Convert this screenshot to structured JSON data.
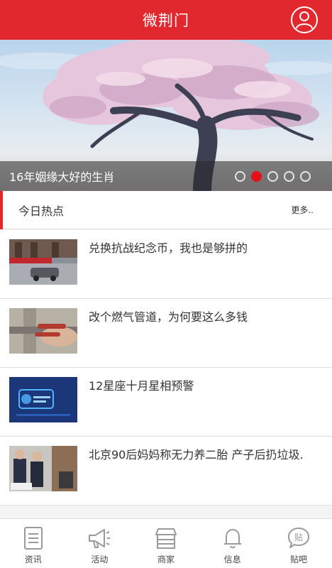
{
  "header": {
    "title": "微荆门",
    "avatar_icon": "user-icon"
  },
  "banner": {
    "caption": "16年姻缘大好的生肖",
    "slide_count": 5,
    "active_slide": 2
  },
  "hot": {
    "title": "今日热点",
    "more": "更多.."
  },
  "news": [
    {
      "title": "兑换抗战纪念币，我也是够拼的"
    },
    {
      "title": "改个燃气管道，为何要这么多钱"
    },
    {
      "title": "12星座十月星相预警"
    },
    {
      "title": "北京90后妈妈称无力养二胎 产子后扔垃圾."
    }
  ],
  "tabs": [
    {
      "label": "资讯",
      "icon": "document-icon"
    },
    {
      "label": "活动",
      "icon": "megaphone-icon"
    },
    {
      "label": "商家",
      "icon": "store-icon"
    },
    {
      "label": "信息",
      "icon": "bell-icon"
    },
    {
      "label": "贴吧",
      "icon": "chat-bubble-icon",
      "glyph": "贴"
    }
  ],
  "colors": {
    "brand": "#e0282e",
    "active_dot": "#e3101a"
  }
}
